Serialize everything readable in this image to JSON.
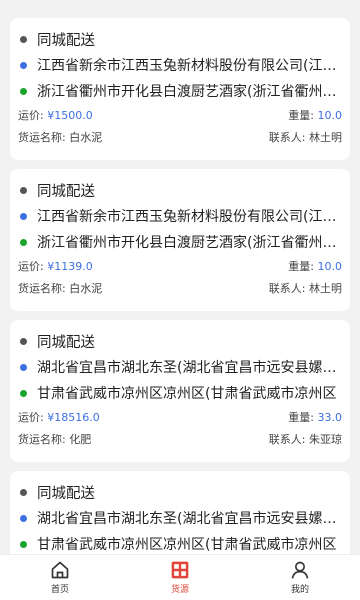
{
  "labels": {
    "freight": "运价: ",
    "weight": "重量: ",
    "goods": "货运名称: ",
    "contact": "联系人: "
  },
  "orders": [
    {
      "type": "同城配送",
      "from": "江西省新余市江西玉兔新材料股份有限公司(江西省新余市",
      "to": "浙江省衢州市开化县白渡厨艺酒家(浙江省衢州市开化县",
      "price": "¥1500.0",
      "weight": "10.0",
      "goods": "白水泥",
      "contact": "林土明"
    },
    {
      "type": "同城配送",
      "from": "江西省新余市江西玉兔新材料股份有限公司(江西省新余市",
      "to": "浙江省衢州市开化县白渡厨艺酒家(浙江省衢州市开化县",
      "price": "¥1139.0",
      "weight": "10.0",
      "goods": "白水泥",
      "contact": "林土明"
    },
    {
      "type": "同城配送",
      "from": "湖北省宜昌市湖北东圣(湖北省宜昌市远安县嫘祖镇",
      "to": "甘肃省武威市凉州区凉州区(甘肃省武威市凉州区",
      "price": "¥18516.0",
      "weight": "33.0",
      "goods": "化肥",
      "contact": "朱亚琼"
    },
    {
      "type": "同城配送",
      "from": "湖北省宜昌市湖北东圣(湖北省宜昌市远安县嫘祖镇",
      "to": "甘肃省武威市凉州区凉州区(甘肃省武威市凉州区",
      "price": "",
      "weight": "",
      "goods": "",
      "contact": ""
    }
  ],
  "tabs": [
    {
      "label": "首页",
      "icon": "home-icon"
    },
    {
      "label": "货源",
      "icon": "grid-icon"
    },
    {
      "label": "我的",
      "icon": "user-icon"
    }
  ],
  "colors": {
    "accent": "#e0463a",
    "blue": "#3d6fe0",
    "green": "#1aa52a"
  }
}
